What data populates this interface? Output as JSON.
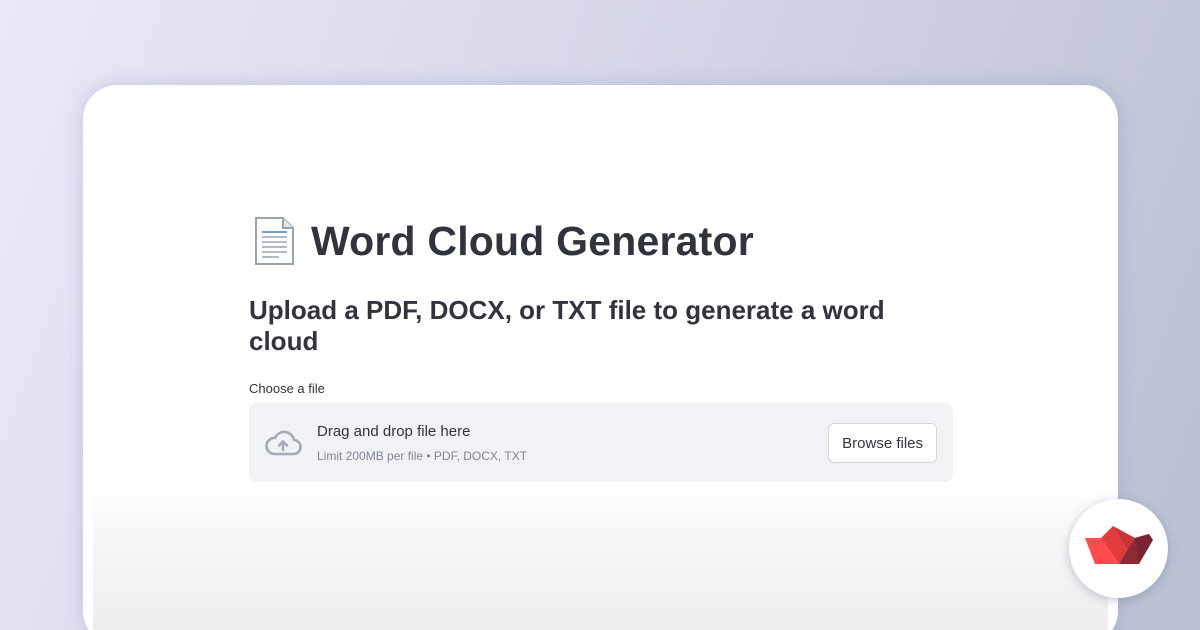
{
  "app": {
    "title": "Word Cloud Generator",
    "subtitle": "Upload a PDF, DOCX, or TXT file to generate a word cloud"
  },
  "uploader": {
    "label": "Choose a file",
    "drop_text": "Drag and drop file here",
    "limit_text": "Limit 200MB per file • PDF, DOCX, TXT",
    "browse_label": "Browse files"
  },
  "icons": {
    "title_icon": "page-document-icon",
    "upload_icon": "cloud-upload-icon",
    "brand_icon": "streamlit-boat-logo"
  },
  "colors": {
    "text": "#31333f",
    "muted": "#808495",
    "dropzone_bg": "#f0f2f6",
    "brand_red": "#ff4b4b"
  }
}
